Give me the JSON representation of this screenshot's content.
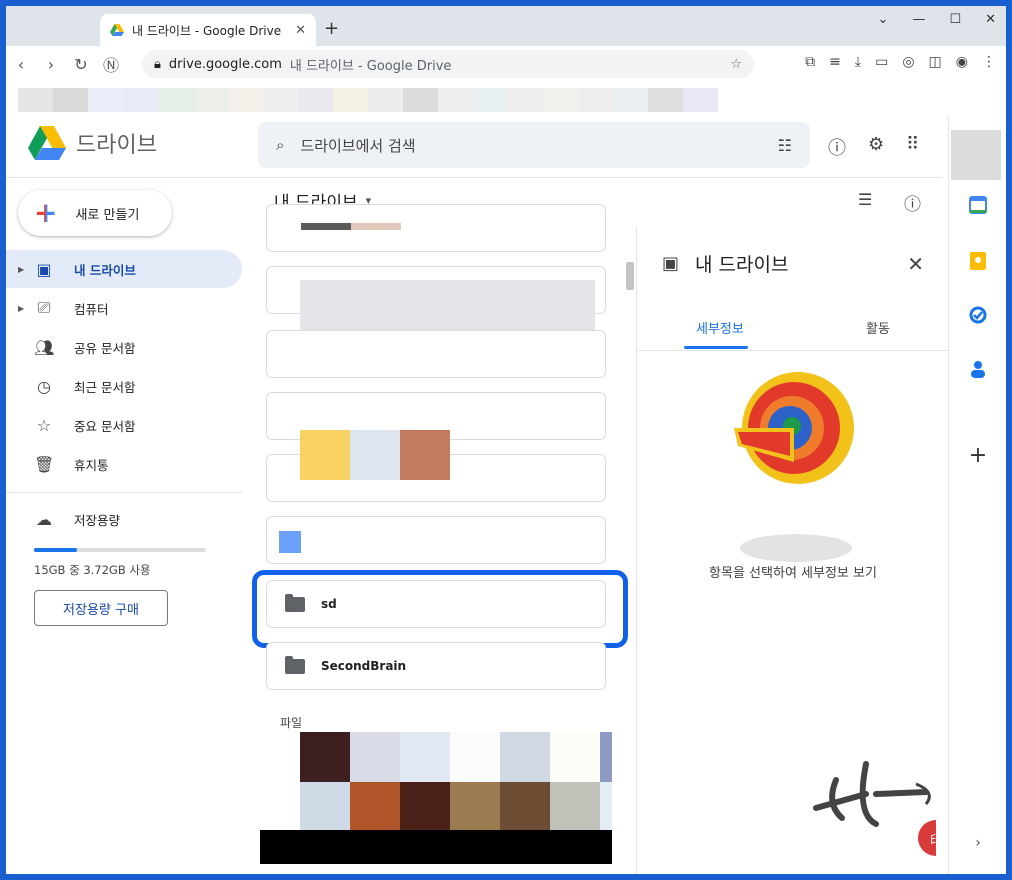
{
  "browser": {
    "tab_title": "내 드라이브 - Google Drive",
    "tab_close": "✕",
    "new_tab": "+",
    "url_host": "drive.google.com",
    "url_rest": "내 드라이브 - Google Drive",
    "window_controls": [
      "⌄",
      "—",
      "☐",
      "✕"
    ],
    "bookmark_colors": [
      "#e6e6e6",
      "#d9d9d9",
      "#eaeef8",
      "#e8ecf6",
      "#e5efe8",
      "#eceee8",
      "#f3efe9",
      "#eeeeee",
      "#e9e9ef",
      "#f5f1e3",
      "#ececec",
      "#dcdcdc",
      "#eeeeee",
      "#e8eff0",
      "#efefef",
      "#eef2ea",
      "#ededed",
      "#e9eff0",
      "#dedede",
      "#e9e8f4"
    ]
  },
  "drive": {
    "app_name": "드라이브",
    "search_placeholder": "드라이브에서 검색",
    "new_button": "새로 만들기",
    "nav": [
      {
        "label": "내 드라이브",
        "icon": "drive-icon"
      },
      {
        "label": "컴퓨터",
        "icon": "computer-icon"
      },
      {
        "label": "공유 문서함",
        "icon": "people-icon"
      },
      {
        "label": "최근 문서함",
        "icon": "clock-icon"
      },
      {
        "label": "중요 문서함",
        "icon": "star-icon"
      },
      {
        "label": "휴지통",
        "icon": "trash-icon"
      }
    ],
    "storage_label": "저장용량",
    "storage_fraction": 0.248,
    "storage_text": "15GB 중 3.72GB 사용",
    "buy_storage": "저장용량 구매",
    "breadcrumb": "내 드라이브",
    "folders": [
      {
        "name": "sd"
      },
      {
        "name": "SecondBrain"
      }
    ],
    "files_section": "파일"
  },
  "details": {
    "title": "내 드라이브",
    "tab_details": "세부정보",
    "tab_activity": "활동",
    "empty_message": "항목을 선택하여 세부정보 보기"
  },
  "colors": {
    "accent": "#1a73e8",
    "highlight": "#1060e8"
  }
}
